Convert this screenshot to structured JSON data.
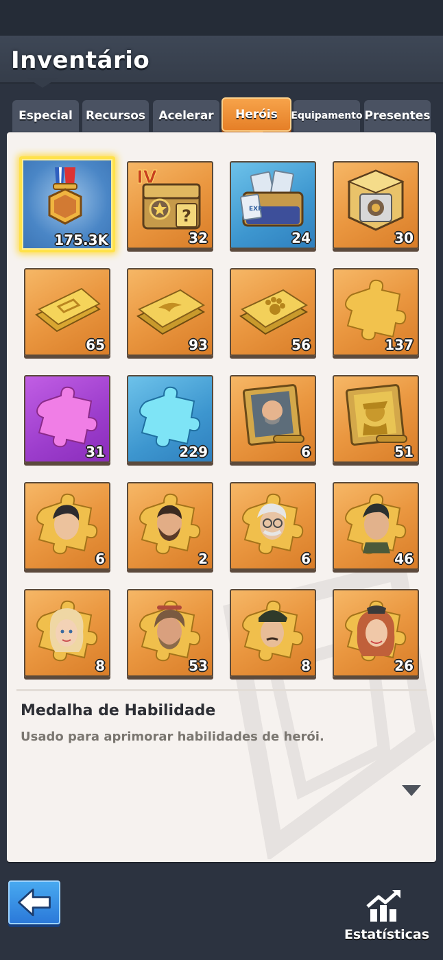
{
  "header": {
    "title": "Inventário"
  },
  "tabs": [
    {
      "label": "Especial",
      "active": false
    },
    {
      "label": "Recursos",
      "active": false
    },
    {
      "label": "Acelerar",
      "active": false
    },
    {
      "label": "Heróis",
      "active": true
    },
    {
      "label": "Equipamento",
      "active": false
    },
    {
      "label": "Presentes",
      "active": false
    }
  ],
  "items": [
    {
      "icon": "skill-medal-icon",
      "count": "175.3K",
      "selected": true
    },
    {
      "icon": "hero-chest-iv-icon",
      "count": "32"
    },
    {
      "icon": "exp-card-crate-icon",
      "count": "24"
    },
    {
      "icon": "gold-cube-chest-icon",
      "count": "30"
    },
    {
      "icon": "gold-ticket-icon",
      "count": "65"
    },
    {
      "icon": "gold-eagle-ticket-icon",
      "count": "93"
    },
    {
      "icon": "gold-paw-ticket-icon",
      "count": "56"
    },
    {
      "icon": "gold-puzzle-piece-icon",
      "count": "137"
    },
    {
      "icon": "purple-puzzle-piece-icon",
      "count": "31"
    },
    {
      "icon": "blue-puzzle-piece-icon",
      "count": "229"
    },
    {
      "icon": "hero-portrait-scroll-icon",
      "count": "6"
    },
    {
      "icon": "gold-hero-portrait-scroll-icon",
      "count": "51"
    },
    {
      "icon": "hero-shard-dark-hair-man-icon",
      "count": "6"
    },
    {
      "icon": "hero-shard-bearded-man-icon",
      "count": "2"
    },
    {
      "icon": "hero-shard-old-man-glasses-icon",
      "count": "6"
    },
    {
      "icon": "hero-shard-soldier-icon",
      "count": "46"
    },
    {
      "icon": "hero-shard-blonde-woman-icon",
      "count": "8"
    },
    {
      "icon": "hero-shard-rugged-man-icon",
      "count": "53"
    },
    {
      "icon": "hero-shard-officer-icon",
      "count": "8"
    },
    {
      "icon": "hero-shard-redhead-woman-icon",
      "count": "26"
    }
  ],
  "detail": {
    "title": "Medalha de Habilidade",
    "description": "Usado para aprimorar habilidades de herói."
  },
  "footer": {
    "stats_label": "Estatísticas"
  }
}
